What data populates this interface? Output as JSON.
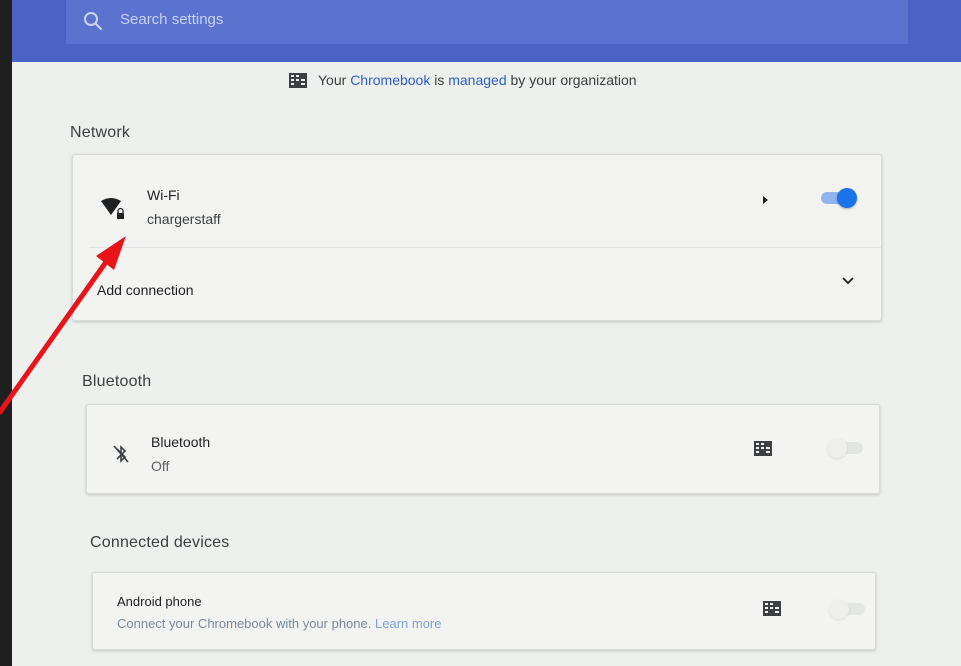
{
  "search": {
    "placeholder": "Search settings"
  },
  "managed": {
    "prefix": "Your ",
    "link": "Chromebook",
    "middle": " is ",
    "link2": "managed",
    "suffix": " by your organization"
  },
  "network": {
    "title": "Network",
    "wifi": {
      "label": "Wi-Fi",
      "network": "chargerstaff",
      "enabled": true
    },
    "add_connection": "Add connection"
  },
  "bluetooth": {
    "title": "Bluetooth",
    "label": "Bluetooth",
    "status": "Off",
    "enabled": false
  },
  "connected_devices": {
    "title": "Connected devices",
    "android": {
      "label": "Android phone",
      "desc": "Connect your Chromebook with your phone.",
      "learn_more": "Learn more"
    }
  },
  "colors": {
    "accent": "#1a73e8",
    "topbar": "#4a63c4",
    "annotation": "#e8141a"
  },
  "icons": [
    "search-icon",
    "building-icon",
    "wifi-lock-icon",
    "chevron-right-icon",
    "chevron-down-icon",
    "bluetooth-disabled-icon"
  ]
}
